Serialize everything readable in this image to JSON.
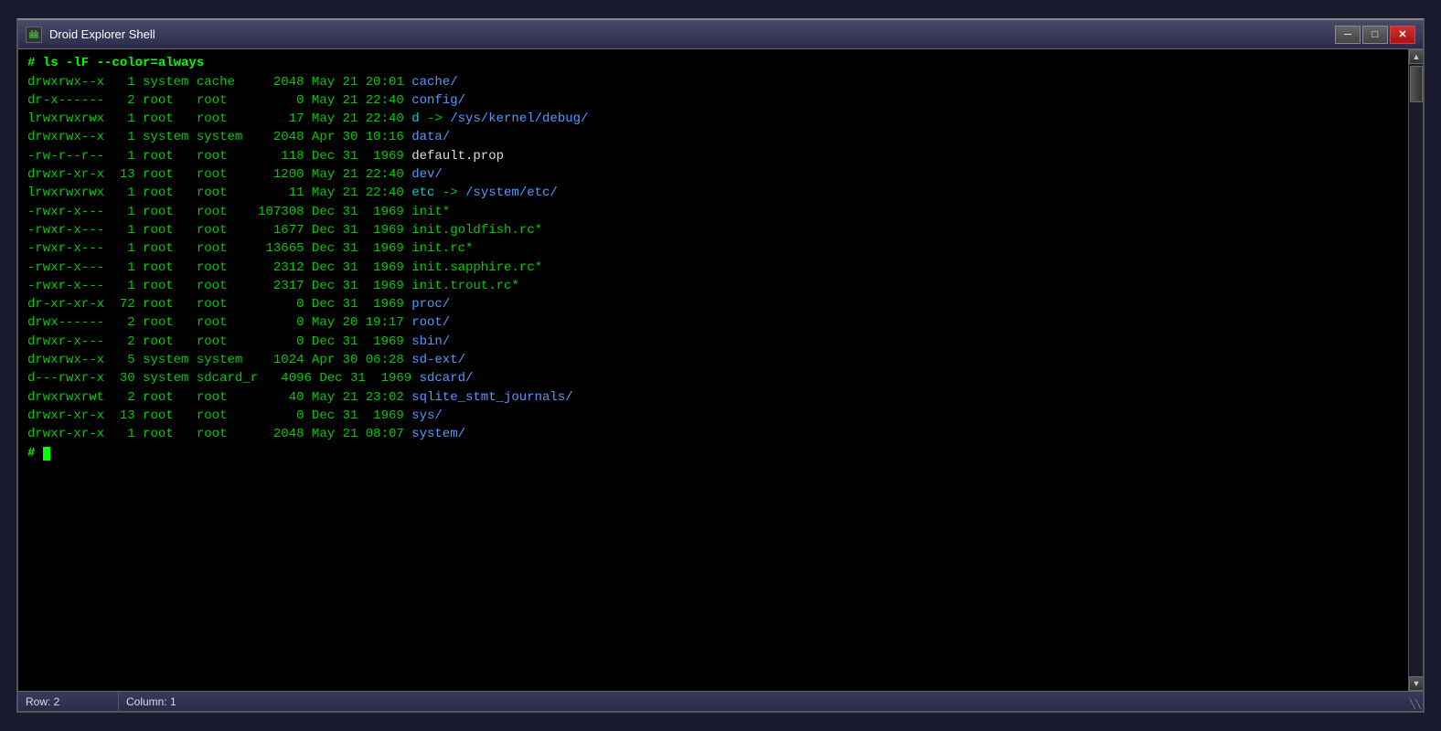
{
  "window": {
    "title": "Droid Explorer Shell",
    "min_label": "─",
    "max_label": "□",
    "close_label": "✕"
  },
  "terminal": {
    "command": "# ls -lF --color=always",
    "entries": [
      {
        "perms": "drwxrwx--x",
        "links": " 1",
        "user": "system",
        "group": "cache  ",
        "size": "  2048",
        "month": "May",
        "day": "21",
        "time": "20:01",
        "name": "cache/",
        "type": "dir"
      },
      {
        "perms": "dr-x------",
        "links": " 2",
        "user": "root  ",
        "group": "root   ",
        "size": "     0",
        "month": "May",
        "day": "21",
        "time": "22:40",
        "name": "config/",
        "type": "dir"
      },
      {
        "perms": "lrwxrwxrwx",
        "links": " 1",
        "user": "root  ",
        "group": "root   ",
        "size": "    17",
        "month": "May",
        "day": "21",
        "time": "22:40",
        "name": "d -> /sys/kernel/debug/",
        "type": "link"
      },
      {
        "perms": "drwxrwx--x",
        "links": " 1",
        "user": "system",
        "group": "system ",
        "size": "  2048",
        "month": "Apr",
        "day": "30",
        "time": "10:16",
        "name": "data/",
        "type": "dir"
      },
      {
        "perms": "-rw-r--r--",
        "links": " 1",
        "user": "root  ",
        "group": "root   ",
        "size": "   118",
        "month": "Dec",
        "day": "31",
        "time": " 1969",
        "name": "default.prop",
        "type": "file"
      },
      {
        "perms": "drwxr-xr-x",
        "links": "13",
        "user": "root  ",
        "group": "root   ",
        "size": "  1200",
        "month": "May",
        "day": "21",
        "time": "22:40",
        "name": "dev/",
        "type": "dir"
      },
      {
        "perms": "lrwxrwxrwx",
        "links": " 1",
        "user": "root  ",
        "group": "root   ",
        "size": "    11",
        "month": "May",
        "day": "21",
        "time": "22:40",
        "name": "etc -> /system/etc/",
        "type": "link"
      },
      {
        "perms": "-rwxr-x---",
        "links": " 1",
        "user": "root  ",
        "group": "root   ",
        "size": "107308",
        "month": "Dec",
        "day": "31",
        "time": " 1969",
        "name": "init*",
        "type": "exec"
      },
      {
        "perms": "-rwxr-x---",
        "links": " 1",
        "user": "root  ",
        "group": "root   ",
        "size": "  1677",
        "month": "Dec",
        "day": "31",
        "time": " 1969",
        "name": "init.goldfish.rc*",
        "type": "exec"
      },
      {
        "perms": "-rwxr-x---",
        "links": " 1",
        "user": "root  ",
        "group": "root   ",
        "size": " 13665",
        "month": "Dec",
        "day": "31",
        "time": " 1969",
        "name": "init.rc*",
        "type": "exec"
      },
      {
        "perms": "-rwxr-x---",
        "links": " 1",
        "user": "root  ",
        "group": "root   ",
        "size": "  2312",
        "month": "Dec",
        "day": "31",
        "time": " 1969",
        "name": "init.sapphire.rc*",
        "type": "exec"
      },
      {
        "perms": "-rwxr-x---",
        "links": " 1",
        "user": "root  ",
        "group": "root   ",
        "size": "  2317",
        "month": "Dec",
        "day": "31",
        "time": " 1969",
        "name": "init.trout.rc*",
        "type": "exec"
      },
      {
        "perms": "dr-xr-xr-x",
        "links": "72",
        "user": "root  ",
        "group": "root   ",
        "size": "     0",
        "month": "Dec",
        "day": "31",
        "time": " 1969",
        "name": "proc/",
        "type": "dir"
      },
      {
        "perms": "drwx------",
        "links": " 2",
        "user": "root  ",
        "group": "root   ",
        "size": "     0",
        "month": "May",
        "day": "20",
        "time": "19:17",
        "name": "root/",
        "type": "dir"
      },
      {
        "perms": "drwxr-x---",
        "links": " 2",
        "user": "root  ",
        "group": "root   ",
        "size": "     0",
        "month": "Dec",
        "day": "31",
        "time": " 1969",
        "name": "sbin/",
        "type": "dir"
      },
      {
        "perms": "drwxrwx--x",
        "links": " 5",
        "user": "system",
        "group": "system ",
        "size": "  1024",
        "month": "Apr",
        "day": "30",
        "time": "06:28",
        "name": "sd-ext/",
        "type": "dir"
      },
      {
        "perms": "d---rwxr-x",
        "links": "30",
        "user": "system",
        "group": "sdcard_r",
        "size": "  4096",
        "month": "Dec",
        "day": "31",
        "time": " 1969",
        "name": "sdcard/",
        "type": "dir"
      },
      {
        "perms": "drwxrwxrwt",
        "links": " 2",
        "user": "root  ",
        "group": "root   ",
        "size": "    40",
        "month": "May",
        "day": "21",
        "time": "23:02",
        "name": "sqlite_stmt_journals/",
        "type": "dir"
      },
      {
        "perms": "drwxr-xr-x",
        "links": "13",
        "user": "root  ",
        "group": "root   ",
        "size": "     0",
        "month": "Dec",
        "day": "31",
        "time": " 1969",
        "name": "sys/",
        "type": "dir"
      },
      {
        "perms": "drwxr-xr-x",
        "links": " 1",
        "user": "root  ",
        "group": "root   ",
        "size": "  2048",
        "month": "May",
        "day": "21",
        "time": "08:07",
        "name": "system/",
        "type": "dir"
      }
    ],
    "prompt": "# "
  },
  "statusbar": {
    "row_label": "Row: 2",
    "col_label": "Column: 1"
  },
  "colors": {
    "green": "#00cc00",
    "cyan": "#00cccc",
    "blue": "#5599ff",
    "bg": "#000000",
    "titlebar_bg": "#3a3a5a"
  }
}
